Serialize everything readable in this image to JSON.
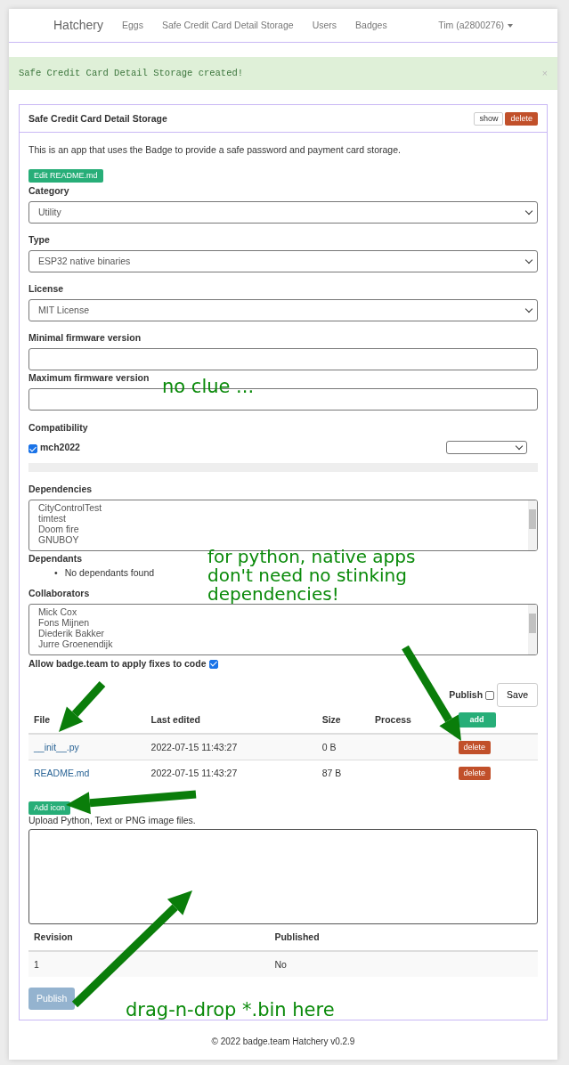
{
  "nav": {
    "brand": "Hatchery",
    "links": [
      "Eggs",
      "Safe Credit Card Detail Storage",
      "Users",
      "Badges"
    ],
    "user": "Tim (a2800276)"
  },
  "alert": {
    "message": "Safe Credit Card Detail Storage created!",
    "close": "×"
  },
  "panel": {
    "title": "Safe Credit Card Detail Storage",
    "show_button": "show",
    "delete_button": "delete",
    "description": "This is an app that uses the Badge to provide a safe password and payment card storage.",
    "edit_button": "Edit README.md",
    "fields": [
      {
        "kind": "select",
        "label": "Category",
        "value": "Utility"
      },
      {
        "kind": "select",
        "label": "Type",
        "value": "ESP32 native binaries"
      },
      {
        "kind": "select",
        "label": "License",
        "value": "MIT License"
      },
      {
        "kind": "input",
        "label": "Minimal firmware version"
      },
      {
        "kind": "input",
        "label": "Maximum firmware version"
      }
    ],
    "compatibility": {
      "label": "Compatibility",
      "items": [
        {
          "name": "mch2022",
          "checked": true
        }
      ]
    },
    "dependencies": {
      "label": "Dependencies",
      "options": [
        "CityControlTest",
        "timtest",
        "Doom fire",
        "GNUBOY"
      ]
    },
    "dependants": {
      "label": "Dependants",
      "marker": "•",
      "items": [
        "No dependants found"
      ]
    },
    "collaborators": {
      "label": "Collaborators",
      "options": [
        "Mick Cox",
        "Fons Mijnen",
        "Diederik Bakker",
        "Jurre Groenendijk"
      ]
    },
    "allow_fixes": {
      "label": "Allow badge.team to apply fixes to code",
      "checked": true
    },
    "publish_check": {
      "label": "Publish",
      "checked": false
    },
    "save_button": "Save",
    "files": {
      "columns": [
        "File",
        "Last edited",
        "Size",
        "Process"
      ],
      "add_button": "add",
      "rows": [
        {
          "file": "__init__.py",
          "edited": "2022-07-15 11:43:27",
          "size": "0 B",
          "action": "delete"
        },
        {
          "file": "README.md",
          "edited": "2022-07-15 11:43:27",
          "size": "87 B",
          "action": "delete"
        }
      ]
    },
    "add_icon_button": "Add icon",
    "upload_hint": "Upload Python, Text or PNG image files.",
    "revisions": {
      "columns": [
        "Revision",
        "Published"
      ],
      "rows": [
        [
          "1",
          "No"
        ]
      ]
    },
    "publish_button": {
      "label": "Publish",
      "disabled": true
    }
  },
  "footer": "© 2022 badge.team Hatchery v0.2.9",
  "annotations": [
    "no clue ...",
    "for python, native apps\ndon't need no stinking\ndependencies!",
    "drag-n-drop *.bin here"
  ]
}
